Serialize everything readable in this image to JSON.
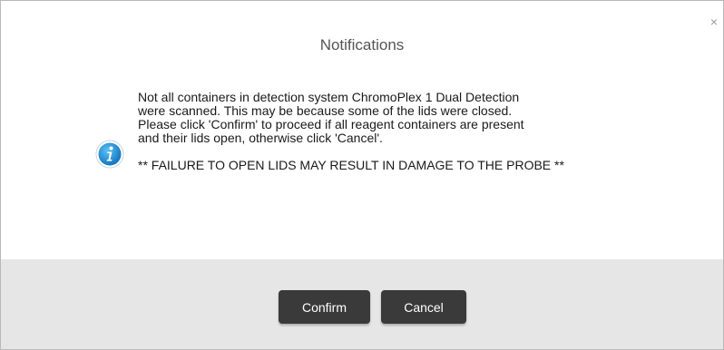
{
  "dialog": {
    "title": "Notifications",
    "close_label": "×",
    "message": "Not all containers in detection system ChromoPlex 1 Dual Detection\nwere scanned. This may be because some of the lids were closed.\nPlease click 'Confirm' to proceed if all reagent containers are present\nand their lids open, otherwise click 'Cancel'.",
    "warning": "** FAILURE TO OPEN LIDS MAY RESULT IN DAMAGE TO THE PROBE **",
    "info_icon": "info-icon",
    "buttons": {
      "confirm_label": "Confirm",
      "cancel_label": "Cancel"
    }
  },
  "colors": {
    "icon_blue": "#1a8fd6",
    "button_bg": "#3a3a3a",
    "footer_bg": "#e6e6e6"
  }
}
